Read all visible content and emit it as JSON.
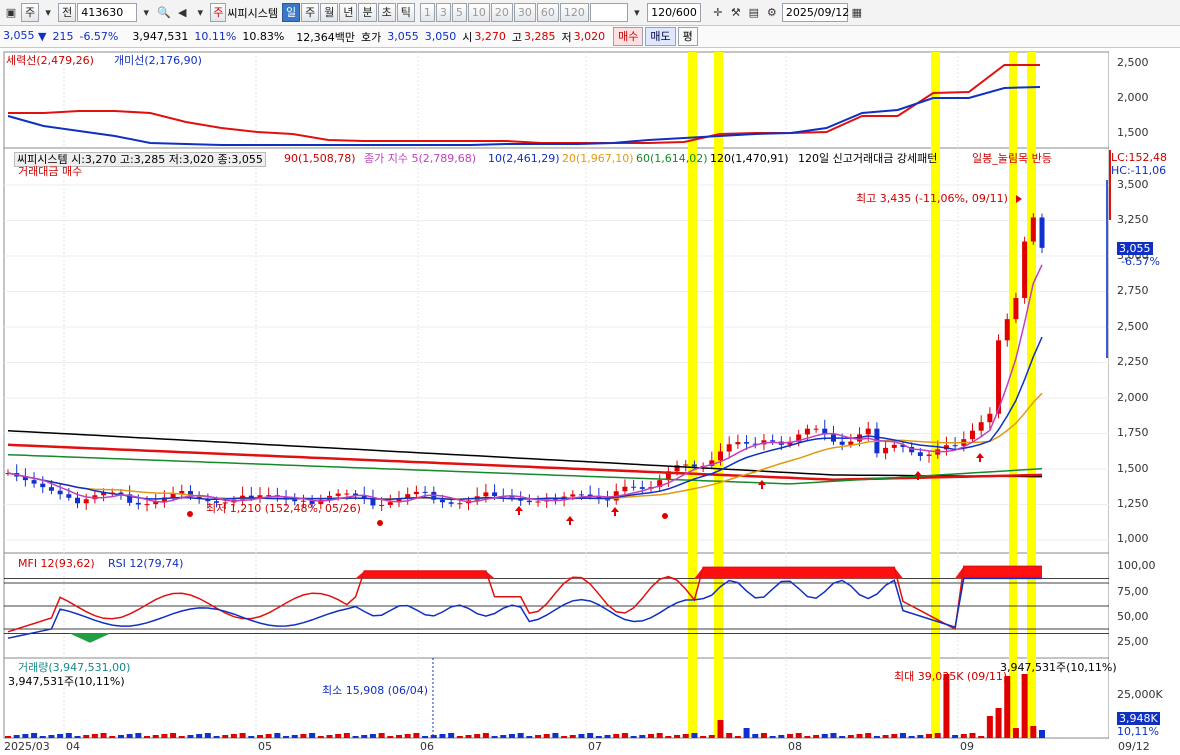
{
  "toolbar": {
    "code_label": "주",
    "prev_label": "전",
    "code": "413630",
    "stock_name": "씨피시스템",
    "stock_badge": "주",
    "periods": [
      "일",
      "주",
      "월",
      "년",
      "분",
      "초",
      "틱"
    ],
    "active_period": "일",
    "minutes": [
      "1",
      "3",
      "5",
      "10",
      "20",
      "30",
      "60",
      "120"
    ],
    "count": "120/600",
    "date": "2025/09/12"
  },
  "quote": {
    "price": "3,055",
    "change_arrow": "▼",
    "change": "215",
    "change_pct": "-6.57%",
    "volume": "3,947,531",
    "vol_ratio": "10.11%",
    "turnover": "10.83%",
    "amount": "12,364백만",
    "bid_label": "호가",
    "ask": "3,055",
    "bid": "3,050",
    "open_label": "시",
    "open": "3,270",
    "high_label": "고",
    "high": "3,285",
    "low_label": "저",
    "low": "3,020",
    "buy_btn": "매수",
    "sell_btn": "매도",
    "eval_btn": "평"
  },
  "panel1": {
    "legend_a": "세력선(2,479,26)",
    "legend_b": "개미선(2,176,90)",
    "axis": [
      "2,500",
      "2,000",
      "1,500"
    ]
  },
  "panel2": {
    "info": "씨피시스템 시:3,270 고:3,285 저:3,020 종:3,055",
    "ma90": "90(1,508,78)",
    "ma5": "종가 지수 5(2,789,68)",
    "ma10": "10(2,461,29)",
    "ma20": "20(1,967,10)",
    "ma60": "60(1,614,02)",
    "ma120": "120(1,470,91)",
    "pattern": "120일 신고거래대금 강세패턴",
    "pattern2": "일봉_눌림목 반등",
    "buy_signal": "거래대금 매수",
    "lc": "LC:152,48",
    "hc": "HC:-11,06",
    "axis": [
      "3,500",
      "3,250",
      "3,000",
      "2,750",
      "2,500",
      "2,250",
      "2,000",
      "1,750",
      "1,500",
      "1,250",
      "1,000"
    ],
    "price_tag": "3,055",
    "price_tag_pct": "-6.57%",
    "high_note": "최고 3,435 (-11,06%, 09/11)",
    "low_note": "최저 1,210 (152,48%, 05/26)"
  },
  "panel3": {
    "mfi": "MFI 12(93,62)",
    "rsi": "RSI 12(79,74)",
    "axis": [
      "100,00",
      "75,00",
      "50,00",
      "25,00"
    ]
  },
  "panel4": {
    "title": "거래량(3,947,531,00)",
    "value": "3,947,531주(10,11%)",
    "min_note": "최소 15,908 (06/04)",
    "max_note": "최대 39,035K (09/11)",
    "last_note": "3,947,531주(10,11%)",
    "axis": "25,000K",
    "vol_tag": "3,948K",
    "vol_tag2": "10,11%"
  },
  "dates": [
    "2025/03",
    "04",
    "05",
    "06",
    "07",
    "08",
    "09",
    "09/12"
  ],
  "colors": {
    "up": "#e00000",
    "down": "#1030d0",
    "highlight": "#ffff00",
    "bg": "#ffffff"
  }
}
